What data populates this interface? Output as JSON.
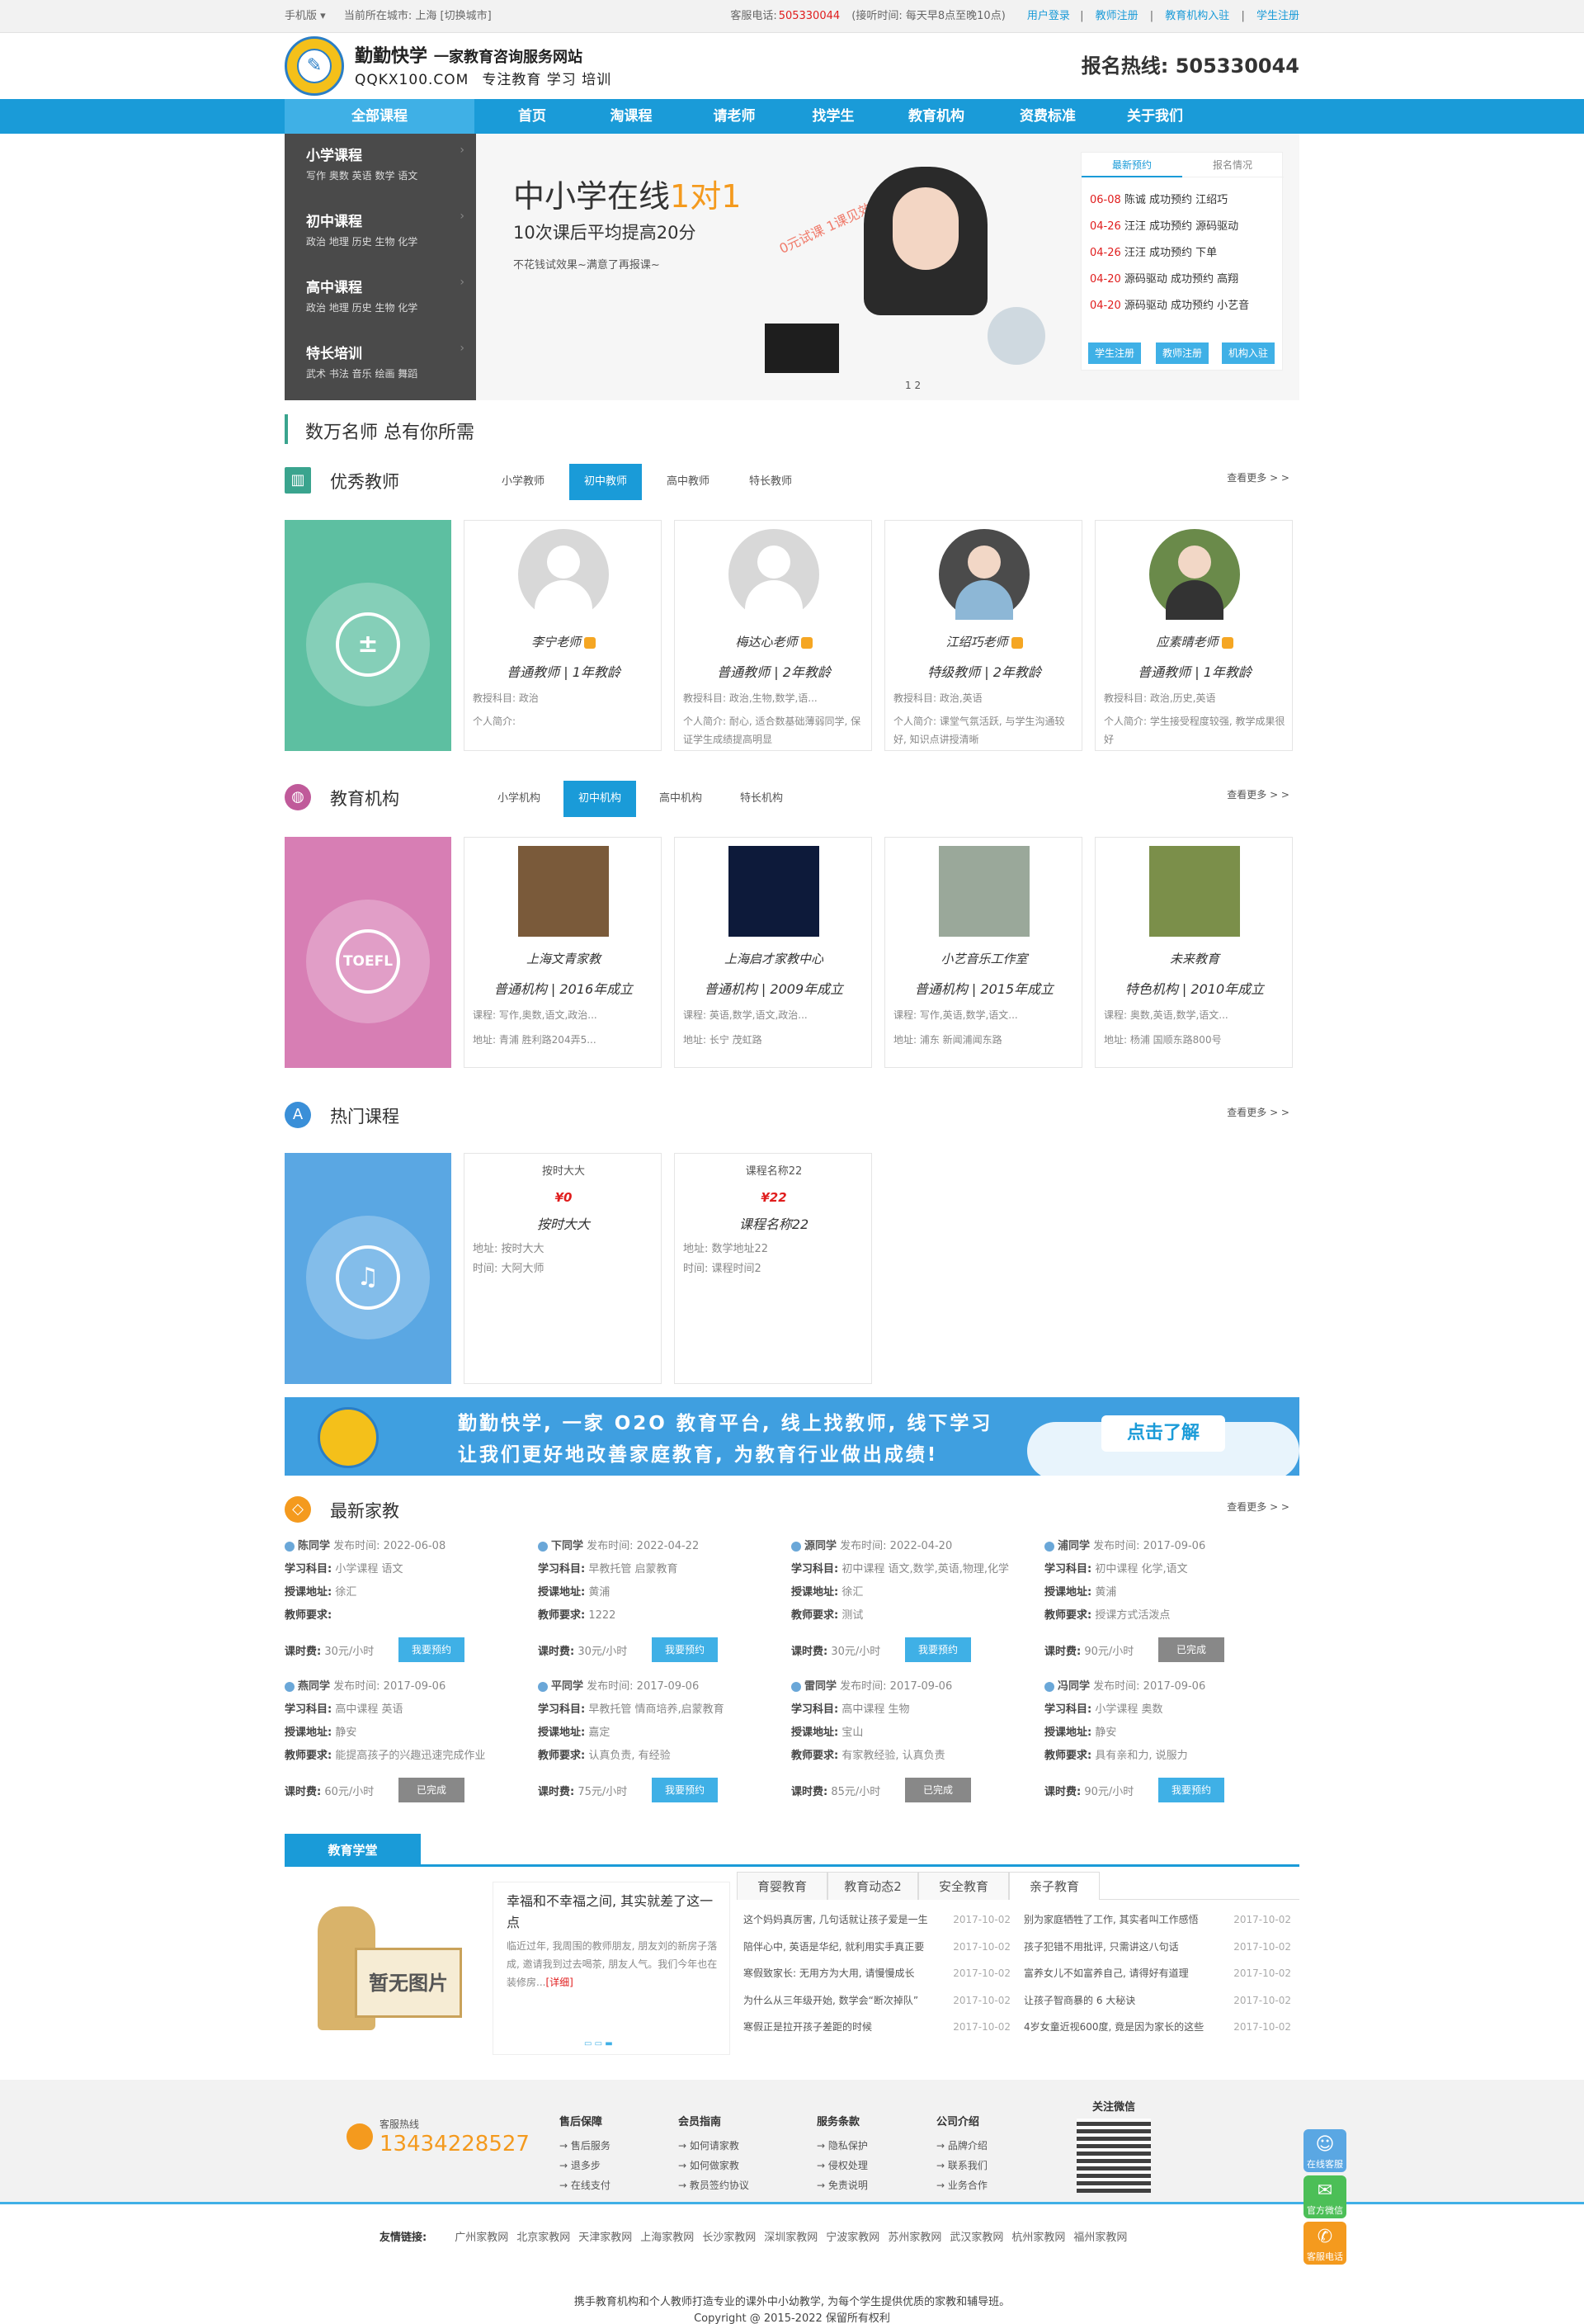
{
  "topbar": {
    "mobile": "手机版 ▾",
    "city_prefix": "当前所在城市:",
    "city": "上海",
    "switch_city": "[切换城市]",
    "service_label": "客服电话:",
    "service_phone": "505330044",
    "hours": "(接听时间: 每天早8点至晚10点)",
    "login": "用户登录",
    "teacher_reg": "教师注册",
    "org_join": "教育机构入驻",
    "student_reg": "学生注册"
  },
  "header": {
    "brand": "勤勤快学",
    "slogan": "一家教育咨询服务网站",
    "domain": "QQKX100.COM",
    "tagline": "专注教育 学习 培训",
    "hotline": "报名热线:  505330044"
  },
  "nav": {
    "all": "全部课程",
    "items": [
      "首页",
      "淘课程",
      "请老师",
      "找学生",
      "教育机构",
      "资费标准",
      "关于我们"
    ]
  },
  "sidemenu": [
    {
      "title": "小学课程",
      "subs": "写作  奥数  英语  数学  语文"
    },
    {
      "title": "初中课程",
      "subs": "政治  地理  历史  生物  化学"
    },
    {
      "title": "高中课程",
      "subs": "政治  地理  历史  生物  化学"
    },
    {
      "title": "特长培训",
      "subs": "武术  书法  音乐  绘画  舞蹈"
    }
  ],
  "banner": {
    "title_a": "中小学在线",
    "title_b": "1对1",
    "sub": "10次课后平均提高20分",
    "note": "不花钱试效果~满意了再报课~",
    "stamp": "0元试课  1课见效!",
    "dots": "1  2"
  },
  "booking": {
    "tab_latest": "最新预约",
    "tab_status": "报名情况",
    "items": [
      {
        "date": "06-08",
        "text": "陈诚 成功预约 江绍巧"
      },
      {
        "date": "04-26",
        "text": "汪汪 成功预约 源码驱动"
      },
      {
        "date": "04-26",
        "text": "汪汪 成功预约 下单"
      },
      {
        "date": "04-20",
        "text": "源码驱动 成功预约 高翔"
      },
      {
        "date": "04-20",
        "text": "源码驱动 成功预约 小艺音"
      }
    ],
    "btn_student": "学生注册",
    "btn_teacher": "教师注册",
    "btn_org": "机构入驻"
  },
  "section_title": "数万名师 总有你所需",
  "teachers": {
    "title": "优秀教师",
    "tabs": [
      "小学教师",
      "初中教师",
      "高中教师",
      "特长教师"
    ],
    "more": "查看更多 > >",
    "tile_color": "#5dbfa1",
    "cards": [
      {
        "name": "李宁老师",
        "level": "普通教师 | 1年教龄",
        "subject": "教授科目: 政治",
        "intro": "个人简介:",
        "photo": "placeholder"
      },
      {
        "name": "梅达心老师",
        "level": "普通教师 | 2年教龄",
        "subject": "教授科目: 政治,生物,数学,语...",
        "intro": "个人简介: 耐心, 适合数基础薄弱同学, 保证学生成绩提高明显",
        "photo": "placeholder"
      },
      {
        "name": "江绍巧老师",
        "level": "特级教师 | 2年教龄",
        "subject": "教授科目: 政治,英语",
        "intro": "个人简介: 课堂气氛活跃, 与学生沟通较好, 知识点讲授清晰",
        "photo": "photo"
      },
      {
        "name": "应素晴老师",
        "level": "普通教师 | 1年教龄",
        "subject": "教授科目: 政治,历史,英语",
        "intro": "个人简介: 学生接受程度较强, 教学成果很好",
        "photo": "photo"
      }
    ]
  },
  "orgs": {
    "title": "教育机构",
    "tabs": [
      "小学机构",
      "初中机构",
      "高中机构",
      "特长机构"
    ],
    "more": "查看更多 > >",
    "tile_color": "#d77eb4",
    "tile_text": "TOEFL",
    "cards": [
      {
        "name": "上海文青家教",
        "type": "普通机构 | 2016年成立",
        "course": "课程: 写作,奥数,语文,政治...",
        "addr": "地址: 青浦  胜利路204弄5..."
      },
      {
        "name": "上海启才家教中心",
        "type": "普通机构 | 2009年成立",
        "course": "课程: 英语,数学,语文,政治...",
        "addr": "地址: 长宁  茂虹路"
      },
      {
        "name": "小艺音乐工作室",
        "type": "普通机构 | 2015年成立",
        "course": "课程: 写作,英语,数学,语文...",
        "addr": "地址: 浦东  新闻浦闻东路"
      },
      {
        "name": "未来教育",
        "type": "特色机构 | 2010年成立",
        "course": "课程: 奥数,英语,数学,语文...",
        "addr": "地址: 杨浦  国顺东路800号"
      }
    ]
  },
  "courses": {
    "title": "热门课程",
    "more": "查看更多 > >",
    "tile_color": "#5aa7e3",
    "cards": [
      {
        "alt": "按时大大",
        "price": "¥0",
        "name": "按时大大",
        "addr": "地址: 按时大大",
        "time": "时间: 大阿大师"
      },
      {
        "alt": "课程名称22",
        "price": "¥22",
        "name": "课程名称22",
        "addr": "地址: 数学地址22",
        "time": "时间: 课程时间2"
      }
    ]
  },
  "promo": {
    "line1": "勤勤快学, 一家 O2O 教育平台, 线上找教师, 线下学习",
    "line2": "让我们更好地改善家庭教育, 为教育行业做出成绩!",
    "button": "点击了解"
  },
  "jobs": {
    "title": "最新家教",
    "more": "查看更多 > >",
    "label_subject": "学习科目:",
    "label_addr": "授课地址:",
    "label_req": "教师要求:",
    "label_fee": "课时费:",
    "items": [
      {
        "name": "陈同学",
        "time": "发布时间: 2022-06-08",
        "subject": "小学课程 语文",
        "addr": "徐汇",
        "req": "",
        "fee": "30元/小时",
        "btn": "我要预约",
        "done": false
      },
      {
        "name": "下同学",
        "time": "发布时间: 2022-04-22",
        "subject": "早教托管 启蒙教育",
        "addr": "黄浦",
        "req": "1222",
        "fee": "30元/小时",
        "btn": "我要预约",
        "done": false
      },
      {
        "name": "源同学",
        "time": "发布时间: 2022-04-20",
        "subject": "初中课程 语文,数学,英语,物理,化学",
        "addr": "徐汇",
        "req": "测试",
        "fee": "30元/小时",
        "btn": "我要预约",
        "done": false
      },
      {
        "name": "浦同学",
        "time": "发布时间: 2017-09-06",
        "subject": "初中课程 化学,语文",
        "addr": "黄浦",
        "req": "授课方式活泼点",
        "fee": "90元/小时",
        "btn": "已完成",
        "done": true
      },
      {
        "name": "燕同学",
        "time": "发布时间: 2017-09-06",
        "subject": "高中课程 英语",
        "addr": "静安",
        "req": "能提高孩子的兴趣迅速完成作业",
        "fee": "60元/小时",
        "btn": "已完成",
        "done": true
      },
      {
        "name": "平同学",
        "time": "发布时间: 2017-09-06",
        "subject": "早教托管 情商培养,启蒙教育",
        "addr": "嘉定",
        "req": "认真负责, 有经验",
        "fee": "75元/小时",
        "btn": "我要预约",
        "done": false
      },
      {
        "name": "雷同学",
        "time": "发布时间: 2017-09-06",
        "subject": "高中课程 生物",
        "addr": "宝山",
        "req": "有家教经验, 认真负责",
        "fee": "85元/小时",
        "btn": "已完成",
        "done": true
      },
      {
        "name": "冯同学",
        "time": "发布时间: 2017-09-06",
        "subject": "小学课程 奥数",
        "addr": "静安",
        "req": "具有亲和力, 说服力",
        "fee": "90元/小时",
        "btn": "我要预约",
        "done": false
      }
    ]
  },
  "edu": {
    "title": "教育学堂",
    "noimg": "暂无图片",
    "article_title": "幸福和不幸福之间, 其实就差了这一点",
    "article_body": "临近过年, 我周围的教师朋友, 朋友刘的新房子落成, 邀请我到过去喝茶, 朋友人气。我们今年也在装修房...",
    "more": "[详细]",
    "tabs": [
      "育婴教育",
      "教育动态2",
      "安全教育",
      "亲子教育"
    ],
    "left": [
      {
        "t": "这个妈妈真厉害, 几句话就让孩子爱是一生",
        "d": "2017-10-02"
      },
      {
        "t": "陪伴心中, 英语是华纪, 就利用实手真正要",
        "d": "2017-10-02"
      },
      {
        "t": "寒假致家长: 无用方为大用, 请慢慢成长",
        "d": "2017-10-02"
      },
      {
        "t": "为什么从三年级开始, 数学会“断次掉队”",
        "d": "2017-10-02"
      },
      {
        "t": "寒假正是拉开孩子差距的时候",
        "d": "2017-10-02"
      }
    ],
    "right": [
      {
        "t": "别为家庭牺牲了工作, 其实者叫工作感悟",
        "d": "2017-10-02"
      },
      {
        "t": "孩子犯错不用批评, 只需讲这八句话",
        "d": "2017-10-02"
      },
      {
        "t": "富养女儿不如富养自己, 请得好有道理",
        "d": "2017-10-02"
      },
      {
        "t": "让孩子智商暴的 6 大秘诀",
        "d": "2017-10-02"
      },
      {
        "t": "4岁女童近视600度, 竟是因为家长的这些",
        "d": "2017-10-02"
      }
    ]
  },
  "footer": {
    "hotline_label": "客服热线",
    "hotline": "13434228527",
    "cols": [
      {
        "h": "售后保障",
        "items": [
          "→ 售后服务",
          "→ 退多步",
          "→ 在线支付"
        ]
      },
      {
        "h": "会员指南",
        "items": [
          "→ 如何请家教",
          "→ 如何做家教",
          "→ 教员签约协议"
        ]
      },
      {
        "h": "服务条款",
        "items": [
          "→ 隐私保护",
          "→ 侵权处理",
          "→ 免责说明"
        ]
      },
      {
        "h": "公司介绍",
        "items": [
          "→ 品牌介绍",
          "→ 联系我们",
          "→ 业务合作"
        ]
      }
    ],
    "wechat": "关注微信",
    "links_label": "友情链接:",
    "links": [
      "广州家教网",
      "北京家教网",
      "天津家教网",
      "上海家教网",
      "长沙家教网",
      "深圳家教网",
      "宁波家教网",
      "苏州家教网",
      "武汉家教网",
      "杭州家教网",
      "福州家教网"
    ],
    "copy1": "携手教育机构和个人教师打造专业的课外中小幼教学, 为每个学生提供优质的家教和辅导班。",
    "copy2": "Copyright @ 2015-2022 保留所有权利"
  },
  "float": [
    {
      "label": "在线客服",
      "icon": "qq-icon",
      "color": "#5aa7e3"
    },
    {
      "label": "官方微信",
      "icon": "wechat-icon",
      "color": "#4cbf57"
    },
    {
      "label": "客服电话",
      "icon": "phone-icon",
      "color": "#f49a1e"
    }
  ]
}
